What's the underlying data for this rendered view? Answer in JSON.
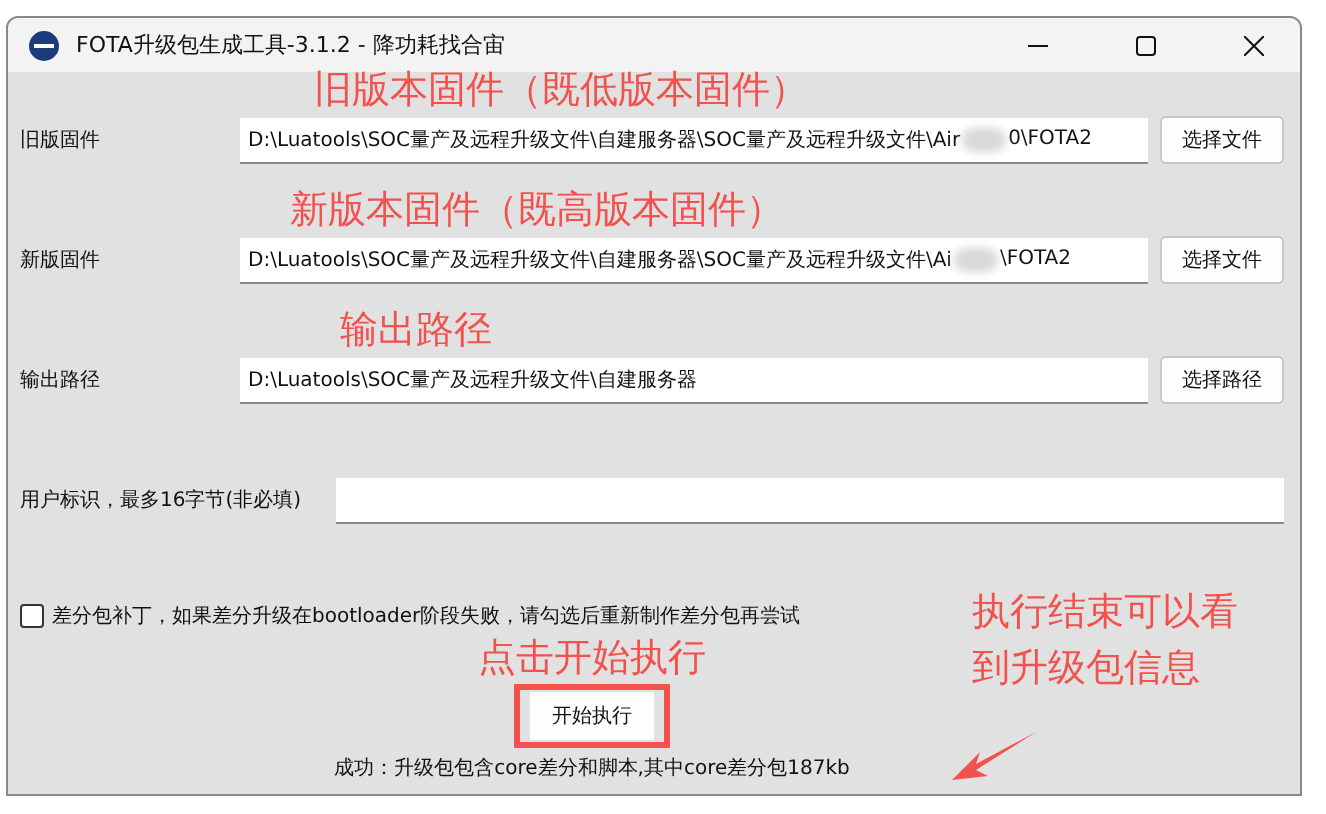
{
  "window": {
    "title": "FOTA升级包生成工具-3.1.2 - 降功耗找合宙"
  },
  "file_rows": [
    {
      "annotation": "旧版本固件（既低版本固件）",
      "label": "旧版固件",
      "value_start": "D:\\Luatools\\SOC量产及远程升级文件\\自建服务器\\SOC量产及远程升级文件\\Air",
      "value_end": "0\\FOTA2",
      "blurred": true,
      "button": "选择文件"
    },
    {
      "annotation": "新版本固件（既高版本固件）",
      "label": "新版固件",
      "value_start": "D:\\Luatools\\SOC量产及远程升级文件\\自建服务器\\SOC量产及远程升级文件\\Ai",
      "value_end": "\\FOTA2",
      "blurred": true,
      "button": "选择文件"
    },
    {
      "annotation": "输出路径",
      "label": "输出路径",
      "value_start": "D:\\Luatools\\SOC量产及远程升级文件\\自建服务器",
      "blurred": false,
      "button": "选择路径"
    }
  ],
  "user_id": {
    "label": "用户标识，最多16字节(非必填)"
  },
  "patch_option": {
    "label": "差分包补丁，如果差分升级在bootloader阶段失败，请勾选后重新制作差分包再尝试",
    "checked": false
  },
  "start": {
    "annotation": "点击开始执行",
    "button": "开始执行"
  },
  "result_annotation": {
    "lines": [
      "执行结束可以看",
      "到升级包信息"
    ]
  },
  "status": "成功：升级包包含core差分和脚本,其中core差分包187kb"
}
